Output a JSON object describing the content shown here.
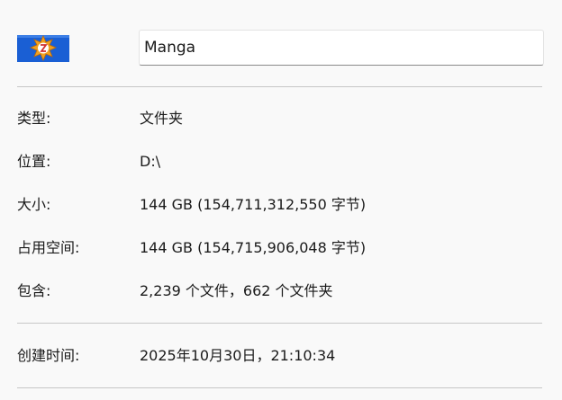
{
  "header": {
    "icon": "folder-custom-icon",
    "name_value": "Manga"
  },
  "general": {
    "type_label": "类型:",
    "type_value": "文件夹",
    "location_label": "位置:",
    "location_value": "D:\\",
    "size_label": "大小:",
    "size_value": "144 GB (154,711,312,550 字节)",
    "size_on_disk_label": "占用空间:",
    "size_on_disk_value": "144 GB (154,715,906,048 字节)",
    "contains_label": "包含:",
    "contains_value": "2,239 个文件，662 个文件夹"
  },
  "dates": {
    "created_label": "创建时间:",
    "created_value": "2025年10月30日，21:10:34"
  },
  "colors": {
    "background": "#f9f9f9",
    "divider": "#c7c7c7",
    "icon_blue": "#1a5fd4",
    "icon_badge": "#f0a020"
  }
}
